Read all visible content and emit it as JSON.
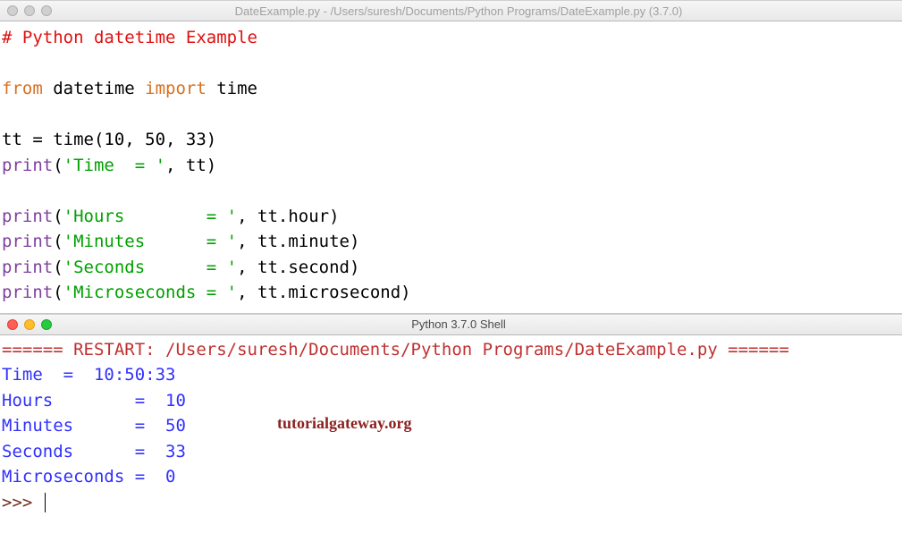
{
  "editor": {
    "title": "DateExample.py - /Users/suresh/Documents/Python Programs/DateExample.py (3.7.0)",
    "code": {
      "comment": "# Python datetime Example",
      "l1_from": "from",
      "l1_mid": " datetime ",
      "l1_import": "import",
      "l1_end": " time",
      "l2": "tt = time(10, 50, 33)",
      "l3_print": "print",
      "l3_open": "(",
      "l3_str": "'Time  = '",
      "l3_end": ", tt)",
      "l4_print": "print",
      "l4_open": "(",
      "l4_str": "'Hours        = '",
      "l4_end": ", tt.hour)",
      "l5_print": "print",
      "l5_open": "(",
      "l5_str": "'Minutes      = '",
      "l5_end": ", tt.minute)",
      "l6_print": "print",
      "l6_open": "(",
      "l6_str": "'Seconds      = '",
      "l6_end": ", tt.second)",
      "l7_print": "print",
      "l7_open": "(",
      "l7_str": "'Microseconds = '",
      "l7_end": ", tt.microsecond)"
    }
  },
  "shell": {
    "title": "Python 3.7.0 Shell",
    "restart_line": "====== RESTART: /Users/suresh/Documents/Python Programs/DateExample.py ======",
    "out1": "Time  =  10:50:33",
    "out2": "Hours        =  10",
    "out3": "Minutes      =  50",
    "out4": "Seconds      =  33",
    "out5": "Microseconds =  0",
    "prompt": ">>> "
  },
  "watermark": "tutorialgateway.org"
}
